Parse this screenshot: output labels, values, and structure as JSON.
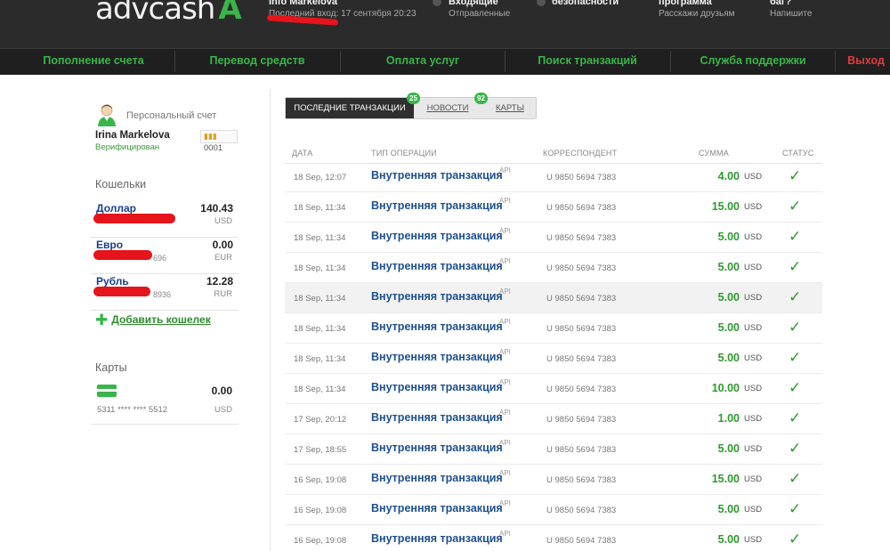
{
  "header": {
    "logo_text": "advcash",
    "logo_mark": "A",
    "account_title": "Info Markelova",
    "last_login": "Последний вход: 17 сентября 20:23",
    "incoming_title": "Входящие",
    "incoming_sub": "Отправленные",
    "security_title": "Настройки безопасности",
    "referral_title": "Реферальная программа",
    "referral_sub": "Расскажи друзьям",
    "bug_title": "Нашли баг?",
    "bug_sub": "Напишите"
  },
  "nav": {
    "items": [
      "Пополнение счета",
      "Перевод средств",
      "Оплата услуг",
      "Поиск транзакций",
      "Служба поддержки"
    ],
    "exit": "Выход",
    "accent_color": "#39b54a",
    "exit_color": "#e23b3b"
  },
  "sidebar": {
    "avatar_icon": "user-avatar-icon",
    "account_type": "Персональный счет",
    "user_name": "Irina Markelova",
    "status": "Верифицирован",
    "badge_value": "0001",
    "wallets_title": "Кошельки",
    "wallets": [
      {
        "name": "Доллар",
        "amount": "140.43",
        "number": "",
        "currency": "USD"
      },
      {
        "name": "Евро",
        "amount": "0.00",
        "number": "696",
        "currency": "EUR"
      },
      {
        "name": "Рубль",
        "amount": "12.28",
        "number": "8936",
        "currency": "RUR"
      }
    ],
    "add_wallet": "Добавить кошелек",
    "cards_title": "Карты",
    "card": {
      "amount": "0.00",
      "number": "5311 **** **** 5512",
      "currency": "USD"
    }
  },
  "tabs": {
    "items": [
      {
        "label": "ПОСЛЕДНИЕ ТРАНЗАКЦИИ",
        "count": "25"
      },
      {
        "label": "НОВОСТИ",
        "count": "92"
      },
      {
        "label": "КАРТЫ",
        "count": ""
      }
    ]
  },
  "table": {
    "headers": [
      "ДАТА",
      "ТИП ОПЕРАЦИИ",
      "КОРРЕСПОНДЕНТ",
      "СУММА",
      "СТАТУС"
    ],
    "rows": [
      {
        "date": "18 Sep, 12:07",
        "type": "Внутренняя транзакция",
        "api": "API",
        "corr": "U 9850 5694 7383",
        "sum": "4.00",
        "cur": "USD",
        "status": "✓"
      },
      {
        "date": "18 Sep, 11:34",
        "type": "Внутренняя транзакция",
        "api": "API",
        "corr": "U 9850 5694 7383",
        "sum": "15.00",
        "cur": "USD",
        "status": "✓"
      },
      {
        "date": "18 Sep, 11:34",
        "type": "Внутренняя транзакция",
        "api": "API",
        "corr": "U 9850 5694 7383",
        "sum": "5.00",
        "cur": "USD",
        "status": "✓"
      },
      {
        "date": "18 Sep, 11:34",
        "type": "Внутренняя транзакция",
        "api": "API",
        "corr": "U 9850 5694 7383",
        "sum": "5.00",
        "cur": "USD",
        "status": "✓"
      },
      {
        "date": "18 Sep, 11:34",
        "type": "Внутренняя транзакция",
        "api": "API",
        "corr": "U 9850 5694 7383",
        "sum": "5.00",
        "cur": "USD",
        "status": "✓"
      },
      {
        "date": "18 Sep, 11:34",
        "type": "Внутренняя транзакция",
        "api": "API",
        "corr": "U 9850 5694 7383",
        "sum": "5.00",
        "cur": "USD",
        "status": "✓"
      },
      {
        "date": "18 Sep, 11:34",
        "type": "Внутренняя транзакция",
        "api": "API",
        "corr": "U 9850 5694 7383",
        "sum": "5.00",
        "cur": "USD",
        "status": "✓"
      },
      {
        "date": "18 Sep, 11:34",
        "type": "Внутренняя транзакция",
        "api": "API",
        "corr": "U 9850 5694 7383",
        "sum": "10.00",
        "cur": "USD",
        "status": "✓"
      },
      {
        "date": "17 Sep, 20:12",
        "type": "Внутренняя транзакция",
        "api": "API",
        "corr": "U 9850 5694 7383",
        "sum": "1.00",
        "cur": "USD",
        "status": "✓"
      },
      {
        "date": "17 Sep, 18:55",
        "type": "Внутренняя транзакция",
        "api": "API",
        "corr": "U 9850 5694 7383",
        "sum": "5.00",
        "cur": "USD",
        "status": "✓"
      },
      {
        "date": "16 Sep, 19:08",
        "type": "Внутренняя транзакция",
        "api": "API",
        "corr": "U 9850 5694 7383",
        "sum": "15.00",
        "cur": "USD",
        "status": "✓"
      },
      {
        "date": "16 Sep, 19:08",
        "type": "Внутренняя транзакция",
        "api": "API",
        "corr": "U 9850 5694 7383",
        "sum": "5.00",
        "cur": "USD",
        "status": "✓"
      },
      {
        "date": "16 Sep, 19:08",
        "type": "Внутренняя транзакция",
        "api": "API",
        "corr": "U 9850 5694 7383",
        "sum": "5.00",
        "cur": "USD",
        "status": "✓"
      }
    ]
  }
}
